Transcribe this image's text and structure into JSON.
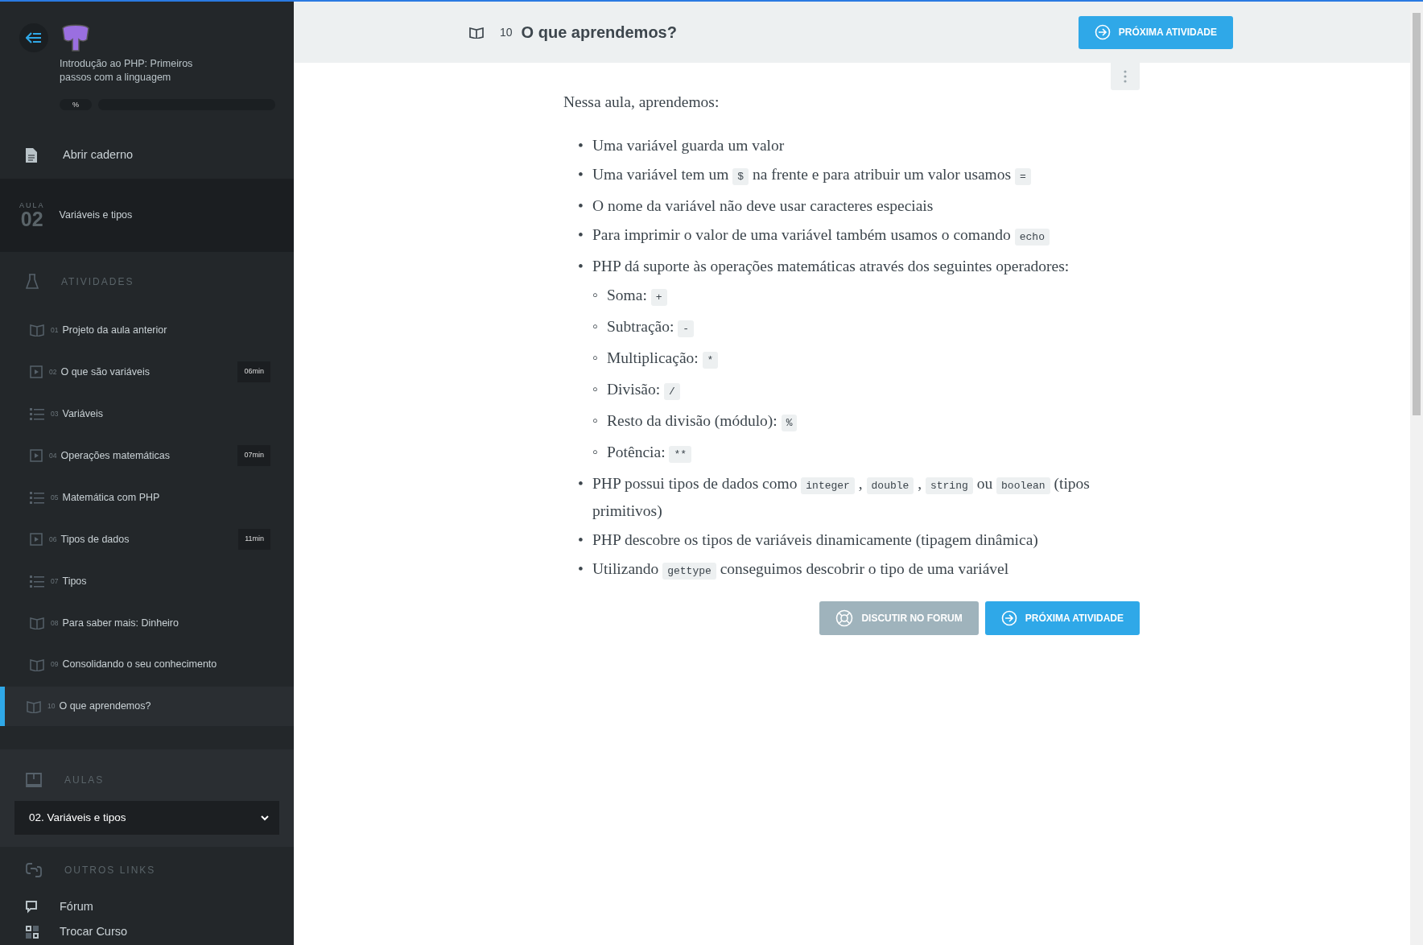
{
  "sidebar": {
    "course_title": "Introdução ao PHP: Primeiros passos com a linguagem",
    "progress": {
      "label": "%",
      "level": 0
    },
    "notebook_link": "Abrir caderno",
    "lesson": {
      "caption": "AULA",
      "number": "02",
      "title": "Variáveis e tipos"
    },
    "activities_heading": "ATIVIDADES",
    "activities": [
      {
        "kind": "reading",
        "number": "01",
        "title": "Projeto da aula anterior",
        "selected": false
      },
      {
        "kind": "video",
        "number": "02",
        "title": "O que são variáveis",
        "duration": "06min",
        "selected": false
      },
      {
        "kind": "exercise",
        "number": "03",
        "title": "Variáveis",
        "selected": false
      },
      {
        "kind": "video",
        "number": "04",
        "title": "Operações matemáticas",
        "duration": "07min",
        "selected": false
      },
      {
        "kind": "exercise",
        "number": "05",
        "title": "Matemática com PHP",
        "selected": false
      },
      {
        "kind": "video",
        "number": "06",
        "title": "Tipos de dados",
        "duration": "11min",
        "selected": false
      },
      {
        "kind": "exercise",
        "number": "07",
        "title": "Tipos",
        "selected": false
      },
      {
        "kind": "reading",
        "number": "08",
        "title": "Para saber mais: Dinheiro",
        "selected": false
      },
      {
        "kind": "reading",
        "number": "09",
        "title": "Consolidando o seu conhecimento",
        "selected": false
      },
      {
        "kind": "reading",
        "number": "10",
        "title": "O que aprendemos?",
        "selected": true
      }
    ],
    "lessons_heading": "AULAS",
    "lesson_select": "02. Variáveis e tipos",
    "links_heading": "OUTROS LINKS",
    "links": [
      {
        "kind": "forum",
        "label": "Fórum"
      },
      {
        "kind": "switch",
        "label": "Trocar Curso"
      }
    ]
  },
  "header": {
    "number": "10",
    "title": "O que aprendemos?",
    "next_button": "PRÓXIMA ATIVIDADE"
  },
  "content": {
    "intro": "Nessa aula, aprendemos:",
    "bullets": [
      {
        "marker": "•",
        "parts": [
          {
            "kind": "text",
            "text": "Uma variável guarda um valor"
          }
        ]
      },
      {
        "marker": "•",
        "parts": [
          {
            "kind": "text",
            "text": "Uma variável tem um "
          },
          {
            "kind": "code",
            "text": "$"
          },
          {
            "kind": "text",
            "text": " na frente e para atribuir um valor usamos "
          },
          {
            "kind": "code",
            "text": "="
          }
        ]
      },
      {
        "marker": "•",
        "parts": [
          {
            "kind": "text",
            "text": "O nome da variável não deve usar caracteres especiais"
          }
        ]
      },
      {
        "marker": "•",
        "parts": [
          {
            "kind": "text",
            "text": "Para imprimir o valor de uma variável também usamos o comando "
          },
          {
            "kind": "code",
            "text": "echo"
          }
        ]
      },
      {
        "marker": "•",
        "parts": [
          {
            "kind": "text",
            "text": "PHP dá suporte às operações matemáticas através dos seguintes operadores:"
          }
        ],
        "children": [
          {
            "marker": "◦",
            "parts": [
              {
                "kind": "text",
                "text": "Soma: "
              },
              {
                "kind": "code",
                "text": "+"
              }
            ]
          },
          {
            "marker": "◦",
            "parts": [
              {
                "kind": "text",
                "text": "Subtração: "
              },
              {
                "kind": "code",
                "text": "-"
              }
            ]
          },
          {
            "marker": "◦",
            "parts": [
              {
                "kind": "text",
                "text": "Multiplicação: "
              },
              {
                "kind": "code",
                "text": "*"
              }
            ]
          },
          {
            "marker": "◦",
            "parts": [
              {
                "kind": "text",
                "text": "Divisão: "
              },
              {
                "kind": "code",
                "text": "/"
              }
            ]
          },
          {
            "marker": "◦",
            "parts": [
              {
                "kind": "text",
                "text": "Resto da divisão (módulo): "
              },
              {
                "kind": "code",
                "text": "%"
              }
            ]
          },
          {
            "marker": "◦",
            "parts": [
              {
                "kind": "text",
                "text": "Potência: "
              },
              {
                "kind": "code",
                "text": "**"
              }
            ]
          }
        ]
      },
      {
        "marker": "•",
        "parts": [
          {
            "kind": "text",
            "text": "PHP possui tipos de dados como "
          },
          {
            "kind": "code",
            "text": "integer"
          },
          {
            "kind": "text",
            "text": " , "
          },
          {
            "kind": "code",
            "text": "double"
          },
          {
            "kind": "text",
            "text": " , "
          },
          {
            "kind": "code",
            "text": "string"
          },
          {
            "kind": "text",
            "text": " ou "
          },
          {
            "kind": "code",
            "text": "boolean"
          },
          {
            "kind": "text",
            "text": " (tipos primitivos)"
          }
        ]
      },
      {
        "marker": "•",
        "parts": [
          {
            "kind": "text",
            "text": "PHP descobre os tipos de variáveis dinamicamente (tipagem dinâmica)"
          }
        ]
      },
      {
        "marker": "•",
        "parts": [
          {
            "kind": "text",
            "text": "Utilizando "
          },
          {
            "kind": "code",
            "text": "gettype"
          },
          {
            "kind": "text",
            "text": " conseguimos descobrir o tipo de uma variável"
          }
        ]
      }
    ],
    "forum_button": "DISCUTIR NO FORUM",
    "next_button": "PRÓXIMA ATIVIDADE"
  }
}
